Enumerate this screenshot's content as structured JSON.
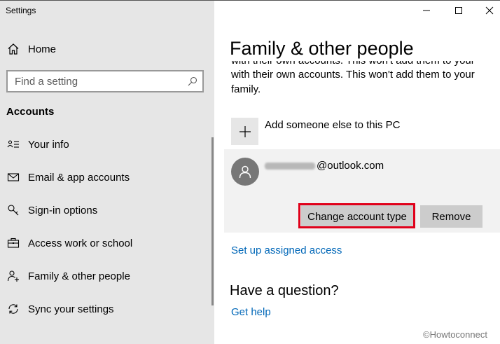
{
  "window": {
    "title": "Settings",
    "controls": [
      "minimize",
      "maximize",
      "close"
    ]
  },
  "sidebar": {
    "home_label": "Home",
    "search_placeholder": "Find a setting",
    "section_title": "Accounts",
    "items": [
      {
        "label": "Your info",
        "icon": "contact-card-icon"
      },
      {
        "label": "Email & app accounts",
        "icon": "mail-icon"
      },
      {
        "label": "Sign-in options",
        "icon": "key-icon"
      },
      {
        "label": "Access work or school",
        "icon": "briefcase-icon"
      },
      {
        "label": "Family & other people",
        "icon": "add-person-icon"
      },
      {
        "label": "Sync your settings",
        "icon": "sync-icon"
      }
    ]
  },
  "main": {
    "title": "Family & other people",
    "description": "with their own accounts. This won't add them to your family.",
    "add_label": "Add someone else to this PC",
    "account": {
      "email_visible": "@outlook.com",
      "email_redacted": true
    },
    "change_button": "Change account type",
    "remove_button": "Remove",
    "assigned_access_link": "Set up assigned access",
    "question_title": "Have a question?",
    "help_link": "Get help"
  },
  "watermark": "©Howtoconnect",
  "colors": {
    "sidebar_bg": "#e6e6e6",
    "link": "#0067b8",
    "button_bg": "#cccccc",
    "highlight_border": "#e0001a",
    "card_bg": "#f2f2f2"
  }
}
